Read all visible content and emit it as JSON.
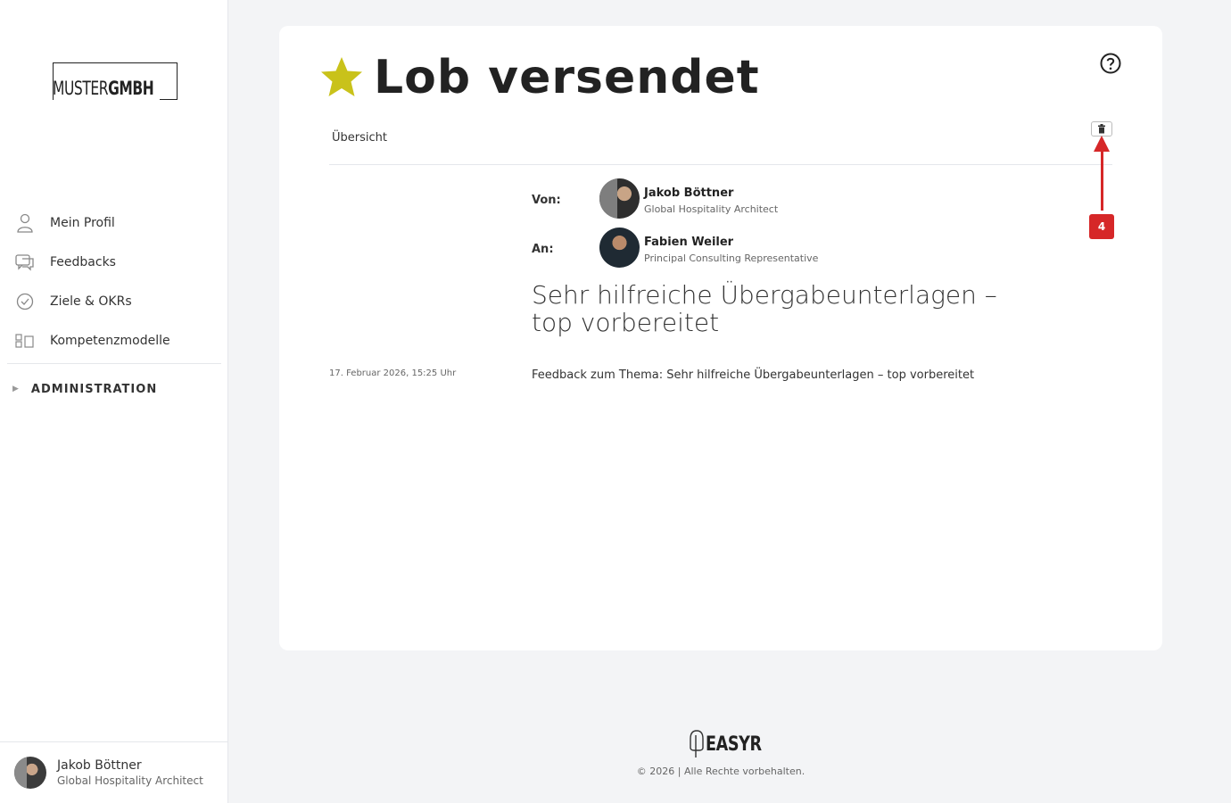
{
  "brand": {
    "logo_light": "MUSTER",
    "logo_bold": "GMBH"
  },
  "sidebar": {
    "items": [
      {
        "label": "Mein Profil",
        "icon": "user-icon"
      },
      {
        "label": "Feedbacks",
        "icon": "chat-bubbles-icon"
      },
      {
        "label": "Ziele & OKRs",
        "icon": "check-circle-icon"
      },
      {
        "label": "Kompetenzmodelle",
        "icon": "grid-icon"
      }
    ],
    "admin_label": "ADMINISTRATION"
  },
  "current_user": {
    "name": "Jakob Böttner",
    "role": "Global Hospitality Architect"
  },
  "page": {
    "title": "Lob versendet",
    "tab": "Übersicht",
    "from_label": "Von:",
    "to_label": "An:",
    "from": {
      "name": "Jakob Böttner",
      "role": "Global Hospitality Architect"
    },
    "to": {
      "name": "Fabien Weiler",
      "role": "Principal Consulting Representative"
    },
    "headline": "Sehr hilfreiche Übergabeunterlagen – top vorbereitet",
    "date": "17. Februar 2026, 15:25 Uhr",
    "body": "Feedback zum Thema: Sehr hilfreiche Übergabeunterlagen – top vorbereitet"
  },
  "annotation": {
    "badge": "4",
    "color": "#d62728"
  },
  "footer": {
    "brand": "EASYR",
    "copyright": "© 2026 | Alle Rechte vorbehalten."
  },
  "colors": {
    "star": "#c9c21a",
    "accent": "#d62728"
  }
}
